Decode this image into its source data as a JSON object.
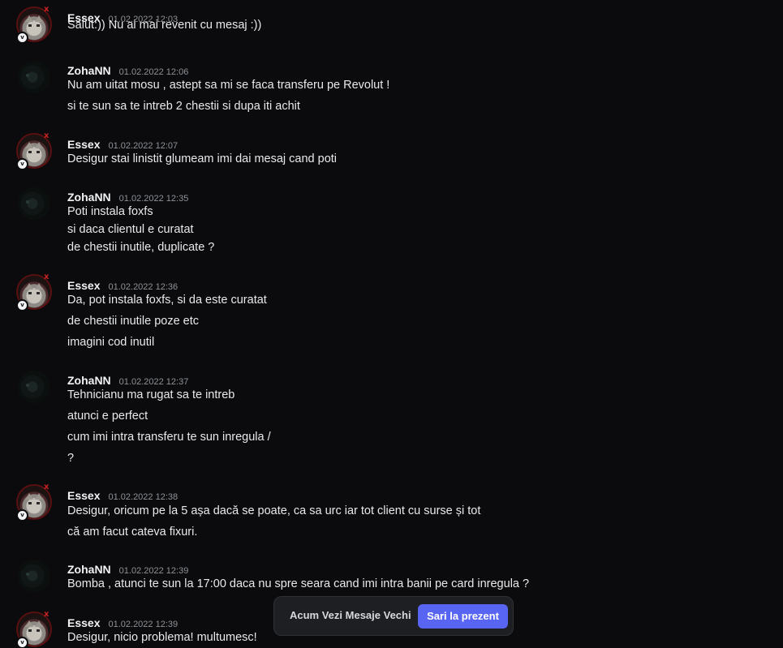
{
  "messages": [
    {
      "author": "Essex",
      "timestamp": "01.02.2022 12:03",
      "avatar_icon": "grumpy-cat-avatar-icon",
      "lines": [
        "Salut:)) Nu ai mai revenit cu mesaj :))"
      ]
    },
    {
      "author": "ZohaNN",
      "timestamp": "01.02.2022 12:06",
      "avatar_icon": "dark-avatar-icon",
      "lines": [
        "Nu am uitat mosu , astept sa mi se faca transferu pe Revolut !",
        "si te sun sa te intreb 2 chestii si dupa iti achit"
      ]
    },
    {
      "author": "Essex",
      "timestamp": "01.02.2022 12:07",
      "avatar_icon": "grumpy-cat-avatar-icon",
      "lines": [
        "Desigur stai linistit glumeam imi dai mesaj cand poti"
      ]
    },
    {
      "author": "ZohaNN",
      "timestamp": "01.02.2022 12:35",
      "avatar_icon": "dark-avatar-icon",
      "lines": [
        "Poti instala foxfs",
        "si daca clientul e curatat",
        "de chestii inutile, duplicate ?"
      ]
    },
    {
      "author": "Essex",
      "timestamp": "01.02.2022 12:36",
      "avatar_icon": "grumpy-cat-avatar-icon",
      "lines": [
        "Da, pot instala foxfs, si da este curatat",
        "de chestii inutile poze etc",
        "imagini cod inutil"
      ]
    },
    {
      "author": "ZohaNN",
      "timestamp": "01.02.2022 12:37",
      "avatar_icon": "dark-avatar-icon",
      "lines": [
        "Tehnicianu ma rugat sa te intreb",
        "atunci e perfect",
        "cum imi intra transferu te sun inregula /",
        "?"
      ]
    },
    {
      "author": "Essex",
      "timestamp": "01.02.2022 12:38",
      "avatar_icon": "grumpy-cat-avatar-icon",
      "lines": [
        "Desigur, oricum pe la 5 așa dacă se poate, ca sa urc iar tot client cu surse și tot",
        "că am facut cateva fixuri."
      ]
    },
    {
      "author": "ZohaNN",
      "timestamp": "01.02.2022 12:39",
      "avatar_icon": "dark-avatar-icon",
      "lines": [
        "Bomba , atunci te sun la 17:00 daca nu spre seara cand imi intra banii pe card inregula ?"
      ]
    },
    {
      "author": "Essex",
      "timestamp": "01.02.2022 12:39",
      "avatar_icon": "grumpy-cat-avatar-icon",
      "lines": [
        "Desigur, nicio problema! multumesc!"
      ]
    }
  ],
  "jump_bar": {
    "label": "Acum Vezi Mesaje Vechi",
    "button": "Sari la prezent"
  },
  "colors": {
    "background": "#0b0b0d",
    "accent": "#5865f2",
    "username": "#f2f3f5",
    "timestamp": "#8e9297"
  }
}
